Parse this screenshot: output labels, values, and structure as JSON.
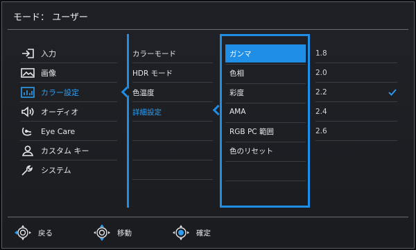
{
  "header": {
    "title": "モード： ユーザー"
  },
  "col1": [
    {
      "label": "入力",
      "icon": "input-icon",
      "active": false
    },
    {
      "label": "画像",
      "icon": "picture-icon",
      "active": false
    },
    {
      "label": "カラー設定",
      "icon": "color-settings-icon",
      "active": true
    },
    {
      "label": "オーディオ",
      "icon": "speaker-icon",
      "active": false
    },
    {
      "label": "Eye Care",
      "icon": "eye-care-icon",
      "active": false
    },
    {
      "label": "カスタム キー",
      "icon": "person-icon",
      "active": false
    },
    {
      "label": "システム",
      "icon": "wrench-icon",
      "active": false
    }
  ],
  "col2": [
    {
      "label": "カラーモード",
      "active": false
    },
    {
      "label": "HDR モード",
      "active": false
    },
    {
      "label": "色温度",
      "active": false
    },
    {
      "label": "詳細設定",
      "active": true
    }
  ],
  "col3": [
    {
      "label": "ガンマ",
      "active": true
    },
    {
      "label": "色相",
      "active": false
    },
    {
      "label": "彩度",
      "active": false
    },
    {
      "label": "AMA",
      "active": false
    },
    {
      "label": "RGB PC 範囲",
      "active": false
    },
    {
      "label": "色のリセット",
      "active": false
    }
  ],
  "col4": [
    {
      "label": "1.8",
      "selected": false
    },
    {
      "label": "2.0",
      "selected": false
    },
    {
      "label": "2.2",
      "selected": true
    },
    {
      "label": "2.4",
      "selected": false
    },
    {
      "label": "2.6",
      "selected": false
    }
  ],
  "footer": {
    "back_label": "戻る",
    "move_label": "移動",
    "confirm_label": "確定"
  },
  "colors": {
    "accent": "#1f8ee6",
    "background": "#1d1f23"
  }
}
